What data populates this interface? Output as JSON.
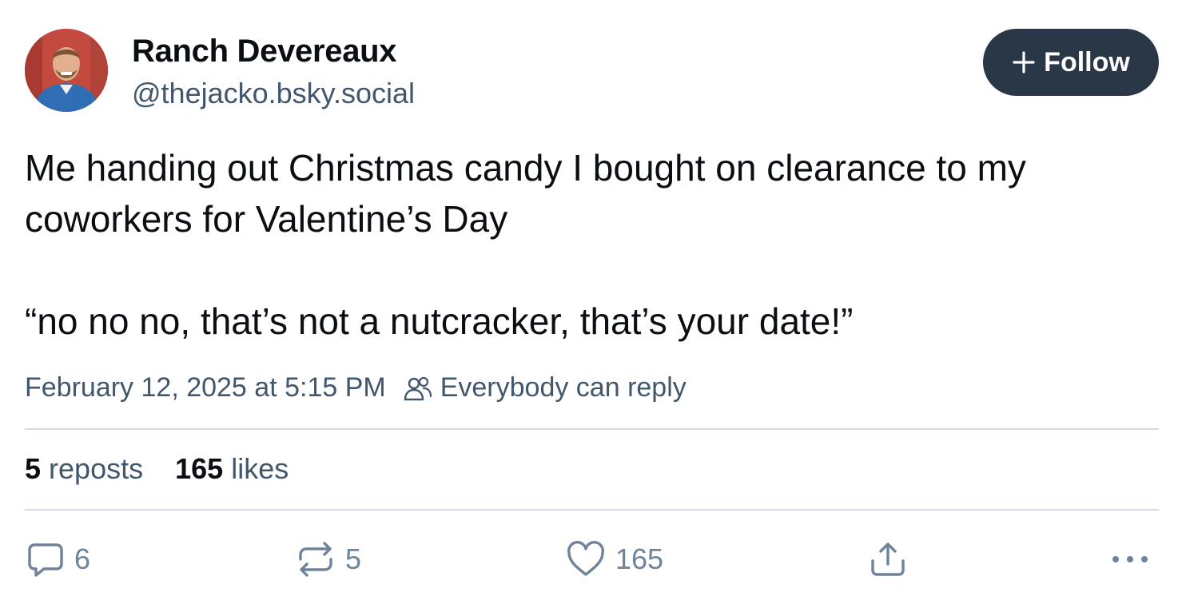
{
  "author": {
    "display_name": "Ranch Devereaux",
    "handle": "@thejacko.bsky.social",
    "avatar_icon": "profile-photo"
  },
  "follow_button": {
    "icon": "plus-icon",
    "label": "Follow"
  },
  "post": {
    "lines": [
      "Me handing out Christmas candy I bought on clearance to my",
      "coworkers for Valentine’s Day",
      "“no no no, that’s not a nutcracker, that’s your date!”"
    ]
  },
  "meta": {
    "timestamp": "February 12, 2025 at 5:15 PM",
    "reply_icon": "people-icon",
    "reply_setting": "Everybody can reply"
  },
  "stats": {
    "reposts_count": "5",
    "reposts_label": "reposts",
    "likes_count": "165",
    "likes_label": "likes"
  },
  "actions": {
    "reply": {
      "icon": "comment-icon",
      "count": "6"
    },
    "repost": {
      "icon": "repost-icon",
      "count": "5"
    },
    "like": {
      "icon": "heart-icon",
      "count": "165"
    },
    "share": {
      "icon": "share-icon"
    },
    "more": {
      "icon": "more-dots-icon"
    }
  },
  "colors": {
    "primary_text": "#0b0f14",
    "secondary_text": "#42576c",
    "action_icon": "#6f839a",
    "follow_bg": "#2a3747",
    "divider": "#d4dbe2"
  }
}
